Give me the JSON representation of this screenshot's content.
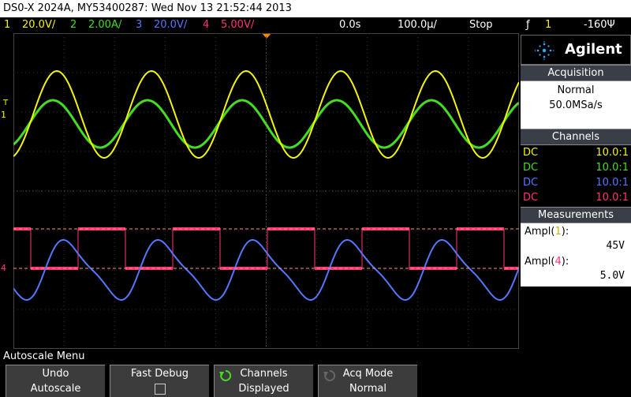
{
  "title": "DS0-X 2024A, MY53400287: Wed Nov 13 21:52:44 2013",
  "status": {
    "ch1": {
      "num": "1",
      "scale": "20.0V/",
      "color": "#f5f500"
    },
    "ch2": {
      "num": "2",
      "scale": "2.00A/",
      "color": "#44dd22"
    },
    "ch3": {
      "num": "3",
      "scale": "20.0V/",
      "color": "#5577ff"
    },
    "ch4": {
      "num": "4",
      "scale": "5.00V/",
      "color": "#ff3377"
    },
    "time_offset": "0.0s",
    "time_scale": "100.0µ/",
    "run_state": "Stop",
    "trigger_edge": "ƒ",
    "trigger_ch": "1",
    "trigger_level": "-160Ψ"
  },
  "panel": {
    "brand": "Agilent",
    "acquisition": {
      "header": "Acquisition",
      "mode": "Normal",
      "rate": "50.0MSa/s"
    },
    "channels": {
      "header": "Channels",
      "rows": [
        {
          "coupling": "DC",
          "probe": "10.0:1",
          "color": "#f5f500"
        },
        {
          "coupling": "DC",
          "probe": "10.0:1",
          "color": "#44dd22"
        },
        {
          "coupling": "DC",
          "probe": "10.0:1",
          "color": "#5577ff"
        },
        {
          "coupling": "DC",
          "probe": "10.0:1",
          "color": "#ff3377"
        }
      ]
    },
    "measurements": {
      "header": "Measurements",
      "m1_label_pre": "Ampl(",
      "m1_ch": "1",
      "m1_label_post": "):",
      "m1_value": "45V",
      "m2_label_pre": "Ampl(",
      "m2_ch": "4",
      "m2_label_post": "):",
      "m2_value": "5.0V"
    }
  },
  "menu": {
    "label": "Autoscale Menu",
    "softkeys": [
      {
        "top": "Undo",
        "bottom": "Autoscale"
      },
      {
        "top": "Fast Debug",
        "bottom": ""
      },
      {
        "top": "Channels",
        "bottom": "Displayed"
      },
      {
        "top": "Acq Mode",
        "bottom": "Normal"
      }
    ]
  },
  "markers": {
    "ch1_marker": "1",
    "trigger_marker": "T",
    "ch4_marker": "4"
  },
  "icons": {
    "agilent_logo": "spark-icon",
    "undo_icon": "undo-icon",
    "acq_icon": "cycle-icon"
  }
}
